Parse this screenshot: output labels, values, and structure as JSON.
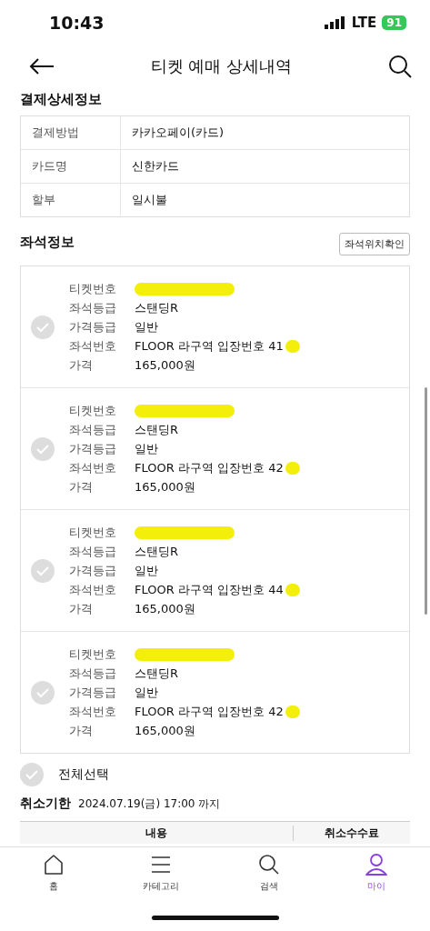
{
  "status_bar": {
    "time": "10:43",
    "network": "LTE",
    "battery": "91"
  },
  "header": {
    "title": "티켓 예매 상세내역"
  },
  "payment": {
    "title": "결제상세정보",
    "rows": [
      {
        "label": "결제방법",
        "value": "카카오페이(카드)"
      },
      {
        "label": "카드명",
        "value": "신한카드"
      },
      {
        "label": "할부",
        "value": "일시불"
      }
    ]
  },
  "seats": {
    "title": "좌석정보",
    "locate_button": "좌석위치확인",
    "tickets": [
      {
        "selected": false,
        "fields": [
          {
            "label": "티켓번호",
            "redacted": true
          },
          {
            "label": "좌석등급",
            "value": "스탠딩R"
          },
          {
            "label": "가격등급",
            "value": "일반"
          },
          {
            "label": "좌석번호",
            "value": "FLOOR 라구역 입장번호 41",
            "redacted": true
          },
          {
            "label": "가격",
            "value": "165,000원"
          }
        ]
      },
      {
        "selected": false,
        "fields": [
          {
            "label": "티켓번호",
            "redacted": true
          },
          {
            "label": "좌석등급",
            "value": "스탠딩R"
          },
          {
            "label": "가격등급",
            "value": "일반"
          },
          {
            "label": "좌석번호",
            "value": "FLOOR 라구역 입장번호 42",
            "redacted": true
          },
          {
            "label": "가격",
            "value": "165,000원"
          }
        ]
      },
      {
        "selected": false,
        "fields": [
          {
            "label": "티켓번호",
            "redacted": true
          },
          {
            "label": "좌석등급",
            "value": "스탠딩R"
          },
          {
            "label": "가격등급",
            "value": "일반"
          },
          {
            "label": "좌석번호",
            "value": "FLOOR 라구역 입장번호 44",
            "redacted": true
          },
          {
            "label": "가격",
            "value": "165,000원"
          }
        ]
      },
      {
        "selected": false,
        "fields": [
          {
            "label": "티켓번호",
            "redacted": true
          },
          {
            "label": "좌석등급",
            "value": "스탠딩R"
          },
          {
            "label": "가격등급",
            "value": "일반"
          },
          {
            "label": "좌석번호",
            "value": "FLOOR 라구역 입장번호 42",
            "redacted": true
          },
          {
            "label": "가격",
            "value": "165,000원"
          }
        ]
      }
    ]
  },
  "select_all": {
    "label": "전체선택",
    "checked": false
  },
  "cancel_deadline": {
    "label": "취소기한",
    "value": "2024.07.19(금) 17:00 까지"
  },
  "fee_table": {
    "columns": [
      "내용",
      "취소수수료"
    ]
  },
  "nav": [
    {
      "label": "홈",
      "kind": "home",
      "selected": false
    },
    {
      "label": "카테고리",
      "kind": "menu",
      "selected": false
    },
    {
      "label": "검색",
      "kind": "search",
      "selected": false
    },
    {
      "label": "마이",
      "kind": "person",
      "selected": true
    }
  ]
}
